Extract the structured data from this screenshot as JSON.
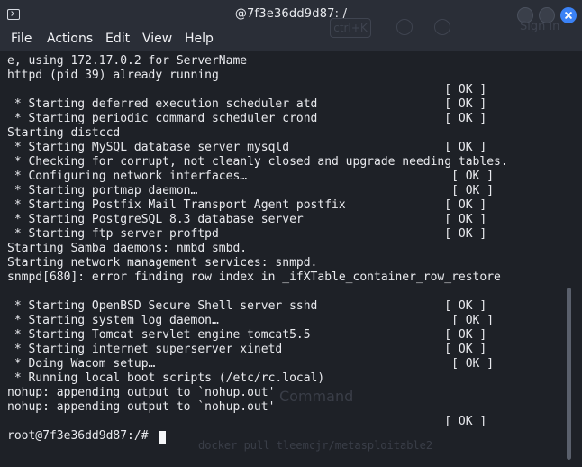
{
  "window": {
    "title": "@7f3e36dd9d87: /",
    "icon": "terminal-icon"
  },
  "menu": {
    "file": "File",
    "actions": "Actions",
    "edit": "Edit",
    "view": "View",
    "help": "Help"
  },
  "background": {
    "shortcut": "ctrl+K",
    "signin": "Sign in",
    "command_heading": "Command",
    "command": "docker pull tleemcjr/metasploitable2"
  },
  "terminal": {
    "lines": [
      "e, using 172.17.0.2 for ServerName",
      "httpd (pid 39) already running",
      "                                                              [ OK ]",
      " * Starting deferred execution scheduler atd                  [ OK ]",
      " * Starting periodic command scheduler crond                  [ OK ]",
      "Starting distccd",
      " * Starting MySQL database server mysqld                      [ OK ]",
      " * Checking for corrupt, not cleanly closed and upgrade needing tables.",
      " * Configuring network interfaces…                             [ OK ]",
      " * Starting portmap daemon…                                    [ OK ]",
      " * Starting Postfix Mail Transport Agent postfix              [ OK ]",
      " * Starting PostgreSQL 8.3 database server                    [ OK ]",
      " * Starting ftp server proftpd                                [ OK ]",
      "Starting Samba daemons: nmbd smbd.",
      "Starting network management services: snmpd.",
      "snmpd[680]: error finding row index in _ifXTable_container_row_restore",
      "",
      " * Starting OpenBSD Secure Shell server sshd                  [ OK ]",
      " * Starting system log daemon…                                 [ OK ]",
      " * Starting Tomcat servlet engine tomcat5.5                   [ OK ]",
      " * Starting internet superserver xinetd                       [ OK ]",
      " * Doing Wacom setup…                                          [ OK ]",
      " * Running local boot scripts (/etc/rc.local)",
      "nohup: appending output to `nohup.out'",
      "nohup: appending output to `nohup.out'",
      "                                                              [ OK ]",
      ""
    ],
    "prompt": "root@7f3e36dd9d87:/# "
  }
}
